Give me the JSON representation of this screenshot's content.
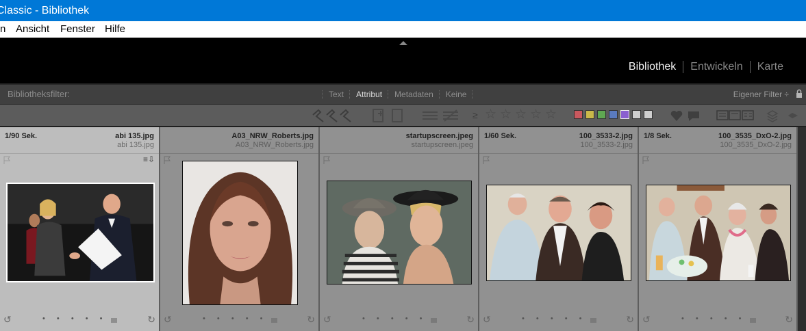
{
  "window": {
    "title": "Classic - Bibliothek"
  },
  "menu": {
    "items": [
      "n",
      "Ansicht",
      "Fenster",
      "Hilfe"
    ]
  },
  "modules": {
    "items": [
      "Bibliothek",
      "Entwickeln",
      "Karte"
    ],
    "active": "Bibliothek"
  },
  "filter_bar": {
    "label": "Bibliotheksfilter:",
    "tabs": [
      "Text",
      "Attribut",
      "Metadaten",
      "Keine"
    ],
    "active_tab": "Attribut",
    "custom_filter": "Eigener Filter ÷"
  },
  "attribute_bar": {
    "rating_operator": "≥",
    "stars": [
      "☆",
      "☆",
      "☆",
      "☆",
      "☆"
    ],
    "color_labels": [
      "#c9585e",
      "#c9b84a",
      "#5fa852",
      "#5a7bbf",
      "#8a5fd0",
      "#cfcfcf",
      "#cfcfcf"
    ]
  },
  "grid": {
    "cells": [
      {
        "shutter": "1/90 Sek.",
        "filename": "abi 135.jpg",
        "filename2": "abi 135.jpg",
        "selected": true
      },
      {
        "shutter": "",
        "filename": "A03_NRW_Roberts.jpg",
        "filename2": "A03_NRW_Roberts.jpg",
        "selected": false
      },
      {
        "shutter": "",
        "filename": "startupscreen.jpeg",
        "filename2": "startupscreen.jpeg",
        "selected": false
      },
      {
        "shutter": "1/60 Sek.",
        "filename": "100_3533-2.jpg",
        "filename2": "100_3533-2.jpg",
        "selected": false
      },
      {
        "shutter": "1/8 Sek.",
        "filename": "100_3535_DxO-2.jpg",
        "filename2": "100_3535_DxO-2.jpg",
        "selected": false
      }
    ],
    "dots": "• • • • •"
  }
}
